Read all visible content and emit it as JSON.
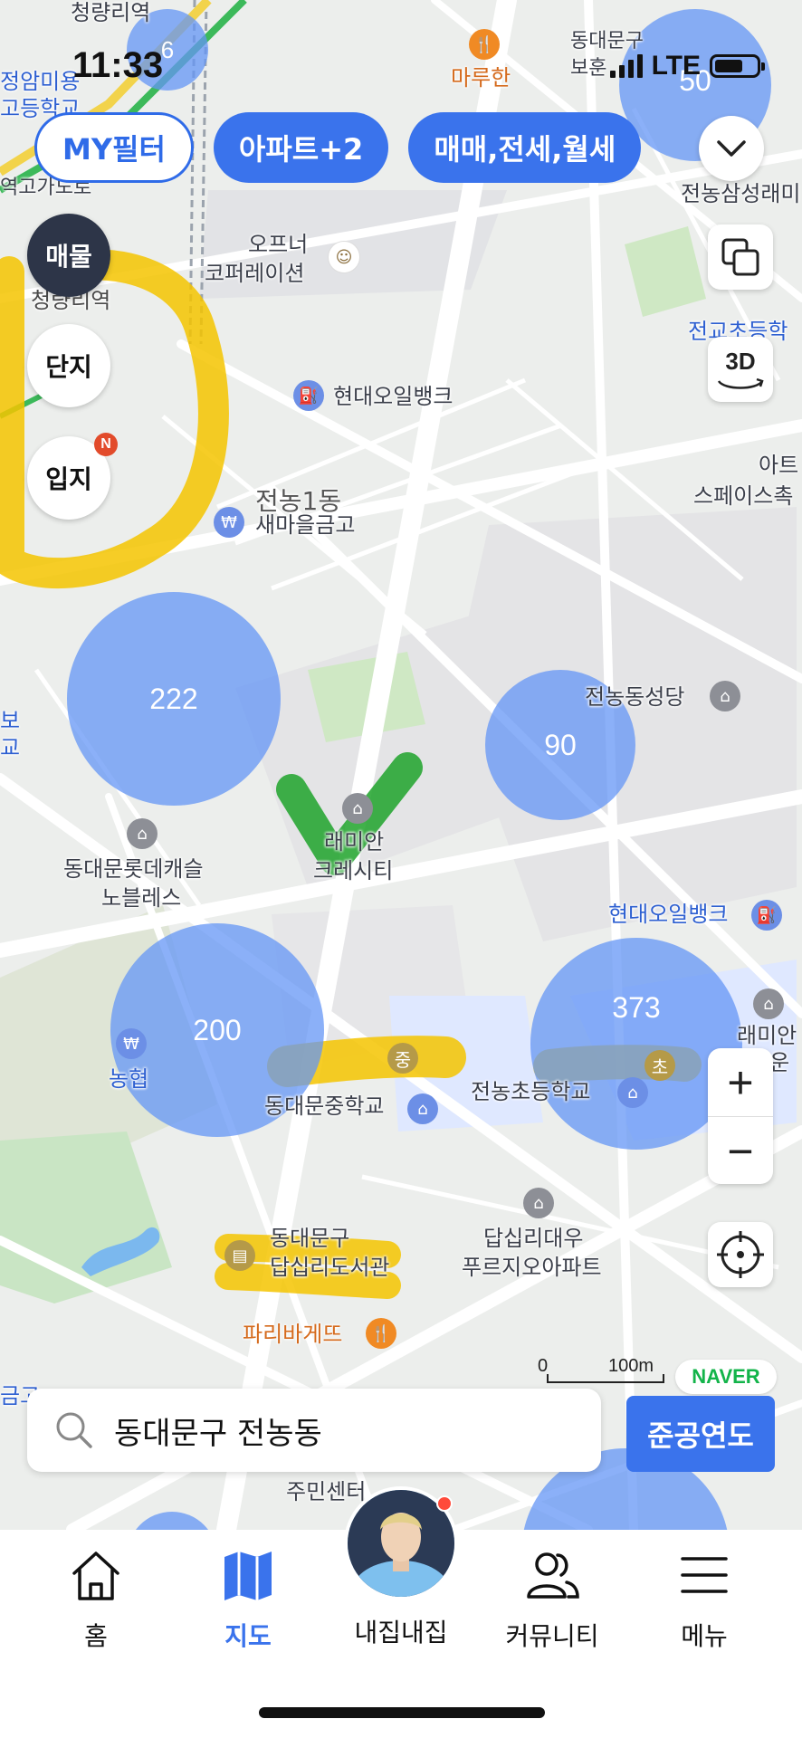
{
  "status": {
    "time": "11:33",
    "network": "LTE"
  },
  "filters": {
    "my_filter": "MY필터",
    "property_type": "아파트+2",
    "deal_type": "매매,전세,월세"
  },
  "map_modes": {
    "listings": "매물",
    "complex": "단지",
    "location": "입지",
    "location_badge": "N"
  },
  "tools": {
    "three_d": "3D"
  },
  "clusters": {
    "c50": "50",
    "c6": "6",
    "c222": "222",
    "c90": "90",
    "c200": "200",
    "c373": "373"
  },
  "places": {
    "cheongnyangni": "청량리역",
    "cheongnyangni2": "청량리역",
    "jeongam": "정암미용",
    "godeung": "고등학교",
    "overpass": "역고가도로",
    "marukhan": "마루한",
    "dongdaemun_top": "동대문구",
    "dongdaemun_top2": "보훈",
    "samsung": "전농삼성래미",
    "opener": "오프너",
    "opener2": "코퍼레이션",
    "oilbank1": "현대오일뱅크",
    "jeongyo": "전교초등학",
    "art": "아트",
    "art2": "스페이스촉",
    "jeonnong1": "전농1동",
    "saemaeul": "새마을금고",
    "cathedral": "전농동성당",
    "raemian_city": "래미안",
    "raemian_city2": "크레시티",
    "lotte": "동대문롯데캐슬",
    "lotte2": "노블레스",
    "oilbank2": "현대오일뱅크",
    "raemian_right": "래미안",
    "raemian_right2": "위운",
    "nonghyup": "농협",
    "middle_school": "동대문중학교",
    "middle_badge": "중",
    "elem_school": "전농초등학교",
    "elem_badge": "초",
    "library": "동대문구",
    "library2": "답십리도서관",
    "daewoo": "답십리대우",
    "daewoo2": "푸르지오아파트",
    "paris": "파리바게뜨",
    "community": "주민센터",
    "left_bo": "보",
    "left_gyo": "교",
    "left_geum": "금고"
  },
  "scale": {
    "zero": "0",
    "dist": "100m"
  },
  "brand": "NAVER",
  "search": {
    "query": "동대문구 전농동"
  },
  "year_button": "준공연도",
  "nav": {
    "home": "홈",
    "map": "지도",
    "myhome": "내집내집",
    "community": "커뮤니티",
    "menu": "메뉴"
  },
  "colors": {
    "accent": "#3a73ec",
    "cluster": "#6496f5",
    "highlight_yellow": "#f5c400",
    "highlight_green": "#1fa32a"
  }
}
